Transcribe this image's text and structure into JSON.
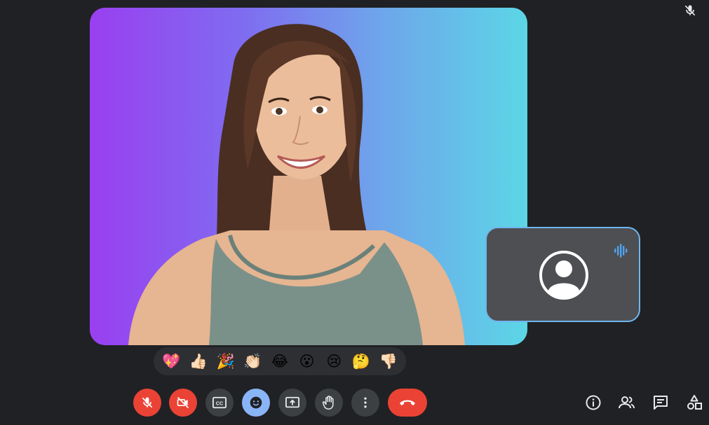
{
  "colors": {
    "background": "#202124",
    "danger": "#ea4335",
    "control": "#3c4043",
    "active_accent": "#8ab4f8",
    "self_tile_border": "#6fb6f0",
    "gradient_start": "#9a3ff0",
    "gradient_end": "#5cd6e6"
  },
  "main_participant": {
    "mic": "muted",
    "video": "on"
  },
  "self_view": {
    "avatar_icon": "account-circle-icon",
    "speaking_indicator": "audio-waveform-icon"
  },
  "reactions": [
    {
      "name": "sparkling-heart",
      "emoji": "💖"
    },
    {
      "name": "thumbs-up",
      "emoji": "👍🏻"
    },
    {
      "name": "party-popper",
      "emoji": "🎉"
    },
    {
      "name": "clapping-hands",
      "emoji": "👏🏻"
    },
    {
      "name": "tears-of-joy",
      "emoji": "😂"
    },
    {
      "name": "surprised",
      "emoji": "😮"
    },
    {
      "name": "crying",
      "emoji": "😢"
    },
    {
      "name": "thinking",
      "emoji": "🤔"
    },
    {
      "name": "thumbs-down",
      "emoji": "👎🏻"
    }
  ],
  "controls": [
    {
      "name": "mic-off",
      "icon": "mic-off-icon",
      "state": "off"
    },
    {
      "name": "camera-off",
      "icon": "videocam-off-icon",
      "state": "off"
    },
    {
      "name": "captions",
      "icon": "closed-caption-icon",
      "label": "CC"
    },
    {
      "name": "reactions",
      "icon": "emoji-icon",
      "state": "active"
    },
    {
      "name": "present",
      "icon": "present-screen-icon"
    },
    {
      "name": "raise-hand",
      "icon": "hand-icon"
    },
    {
      "name": "more-options",
      "icon": "more-vert-icon"
    },
    {
      "name": "leave-call",
      "icon": "call-end-icon"
    }
  ],
  "side_controls": [
    {
      "name": "meeting-details",
      "icon": "info-icon"
    },
    {
      "name": "people",
      "icon": "people-icon"
    },
    {
      "name": "chat",
      "icon": "chat-icon"
    },
    {
      "name": "activities",
      "icon": "shapes-icon"
    }
  ]
}
